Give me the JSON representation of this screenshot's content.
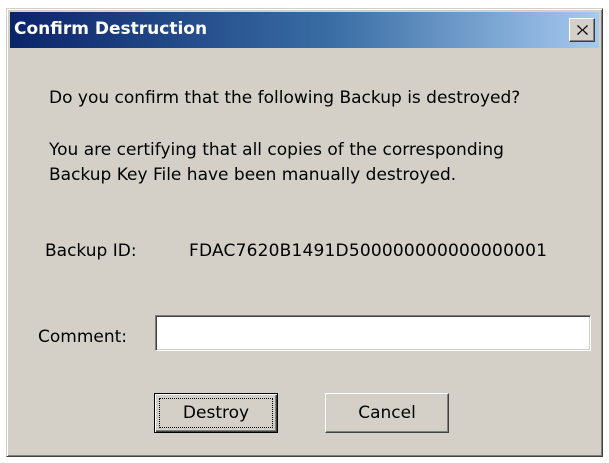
{
  "window": {
    "title": "Confirm Destruction",
    "close_label": "X"
  },
  "message": {
    "question": "Do you confirm that the following Backup is destroyed?",
    "certify_line1": "You are certifying that all copies of the corresponding",
    "certify_line2": "Backup Key File have been manually destroyed."
  },
  "backup": {
    "id_label": "Backup ID:",
    "id_value": "FDAC7620B1491D500000000000000001"
  },
  "comment": {
    "label": "Comment:",
    "value": "",
    "placeholder": ""
  },
  "buttons": {
    "destroy_label": "Destroy",
    "cancel_label": "Cancel"
  },
  "colors": {
    "titlebar_start": "#0a246a",
    "titlebar_end": "#a6caf0",
    "face": "#d4d0c8"
  }
}
